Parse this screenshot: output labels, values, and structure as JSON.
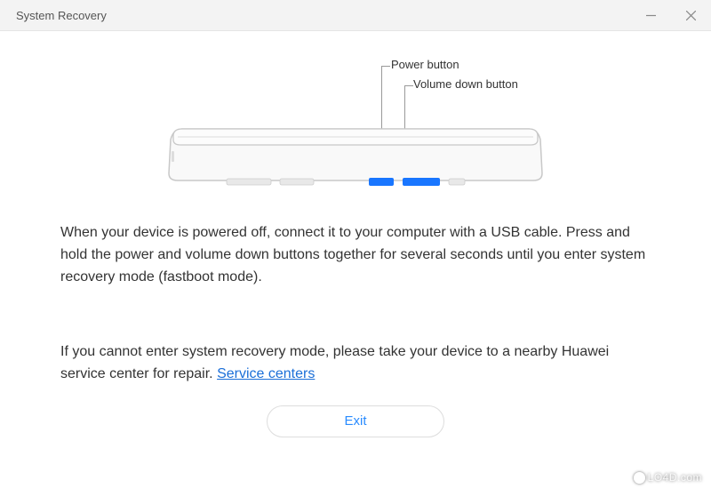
{
  "titlebar": {
    "title": "System Recovery"
  },
  "diagram": {
    "label_power": "Power button",
    "label_volume": "Volume down button"
  },
  "instructions": "When your device is powered off, connect it to your computer with a USB cable. Press and hold the power and volume down buttons together for several seconds until you enter system recovery mode (fastboot mode).",
  "help": {
    "text": "If you cannot enter system recovery mode, please take your device to a nearby Huawei service center for repair. ",
    "link_label": "Service centers"
  },
  "buttons": {
    "exit": "Exit"
  },
  "watermark": "LO4D.com"
}
